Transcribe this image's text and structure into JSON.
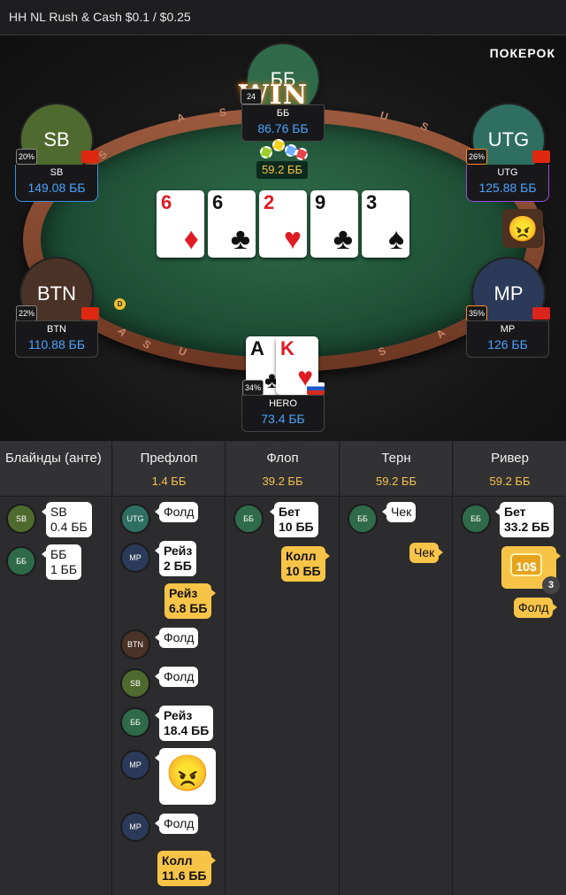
{
  "window": {
    "title": "HH NL Rush & Cash $0.1 / $0.25",
    "brand": "ПОКЕРОК"
  },
  "table": {
    "pot": "59.2 ББ",
    "win_label": "WIN",
    "dealer_label": "D",
    "rail_letters": [
      "S",
      "A",
      "S",
      "U",
      "S",
      "A",
      "S",
      "U",
      "S",
      "A"
    ],
    "board": [
      {
        "rank": "6",
        "suit": "♦",
        "color": "red"
      },
      {
        "rank": "6",
        "suit": "♣",
        "color": "black"
      },
      {
        "rank": "2",
        "suit": "♥",
        "color": "red"
      },
      {
        "rank": "9",
        "suit": "♣",
        "color": "black"
      },
      {
        "rank": "3",
        "suit": "♠",
        "color": "black"
      }
    ],
    "seats": {
      "bb": {
        "avatar_label": "ББ",
        "name": "ББ",
        "stack": "86.76 ББ",
        "pct": "24",
        "flag": "none"
      },
      "sb": {
        "avatar_label": "SB",
        "name": "SB",
        "stack": "149.08 ББ",
        "pct": "20%",
        "flag": "cn"
      },
      "utg": {
        "avatar_label": "UTG",
        "name": "UTG",
        "stack": "125.88 ББ",
        "pct": "26%",
        "flag": "hk"
      },
      "btn": {
        "avatar_label": "BTN",
        "name": "BTN",
        "stack": "110.88 ББ",
        "pct": "22%",
        "flag": "cn"
      },
      "mp": {
        "avatar_label": "MP",
        "name": "MP",
        "stack": "126 ББ",
        "pct": "35%",
        "flag": "vn"
      },
      "hero": {
        "name": "HERO",
        "stack": "73.4 ББ",
        "pct": "34%",
        "flag": "ru",
        "cards": [
          {
            "rank": "A",
            "suit": "♣",
            "color": "black"
          },
          {
            "rank": "K",
            "suit": "♥",
            "color": "red"
          }
        ]
      }
    },
    "emote_icon": "angry-face-icon"
  },
  "history": {
    "columns": [
      {
        "name": "Блайнды (анте)",
        "pot": ""
      },
      {
        "name": "Префлоп",
        "pot": "1.4 ББ"
      },
      {
        "name": "Флоп",
        "pot": "39.2 ББ"
      },
      {
        "name": "Терн",
        "pot": "59.2 ББ"
      },
      {
        "name": "Ривер",
        "pot": "59.2 ББ"
      }
    ],
    "blinds": [
      {
        "pos": "SB",
        "line1": "SB",
        "line2": "0.4 ББ"
      },
      {
        "pos": "ББ",
        "line1": "ББ",
        "line2": "1 ББ"
      }
    ],
    "preflop": [
      {
        "pos": "UTG",
        "text": "Фолд"
      },
      {
        "pos": "MP",
        "line1": "Рейз",
        "line2": "2 ББ"
      },
      {
        "hero": true,
        "line1": "Рейз",
        "line2": "6.8 ББ"
      },
      {
        "pos": "BTN",
        "text": "Фолд"
      },
      {
        "pos": "SB",
        "text": "Фолд"
      },
      {
        "pos": "ББ",
        "line1": "Рейз",
        "line2": "18.4 ББ"
      },
      {
        "pos": "MP",
        "emote": "angry-face-icon"
      },
      {
        "pos": "MP",
        "text": "Фолд"
      },
      {
        "hero": true,
        "line1": "Колл",
        "line2": "11.6 ББ"
      }
    ],
    "flop": [
      {
        "pos": "ББ",
        "line1": "Бет",
        "line2": "10 ББ"
      },
      {
        "hero": true,
        "line1": "Колл",
        "line2": "10 ББ"
      }
    ],
    "turn": [
      {
        "pos": "ББ",
        "text": "Чек"
      },
      {
        "hero": true,
        "text": "Чек"
      }
    ],
    "river": [
      {
        "pos": "ББ",
        "line1": "Бет",
        "line2": "33.2 ББ"
      },
      {
        "hero": true,
        "sticker": "10$",
        "sticker_count": "3"
      },
      {
        "hero": true,
        "text": "Фолд"
      }
    ]
  }
}
